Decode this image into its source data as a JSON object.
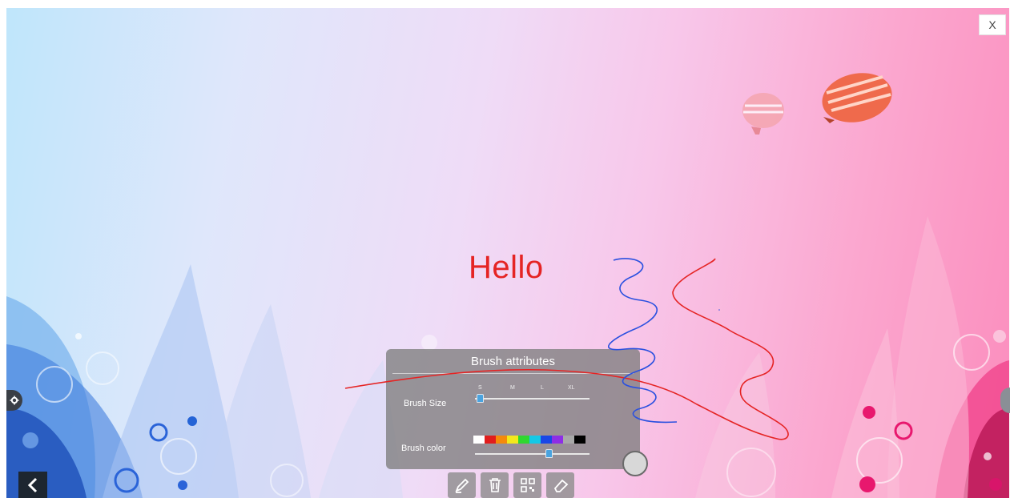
{
  "window": {
    "close_label": "X"
  },
  "canvas_text": {
    "greeting": "Hello"
  },
  "brush_panel": {
    "title": "Brush attributes",
    "size_label": "Brush Size",
    "size_ticks": [
      "S",
      "M",
      "L",
      "XL"
    ],
    "size_value": "S",
    "color_label": "Brush color",
    "colors": [
      "#ffffff",
      "#e11d1d",
      "#f58a0b",
      "#f3e81b",
      "#30d72f",
      "#14c8e6",
      "#1a47e6",
      "#8e2ee6",
      "#a8a8a8",
      "#000000"
    ],
    "color_slider_fraction": 0.64
  },
  "toolbar": {
    "icons": [
      "pen-icon",
      "trash-icon",
      "qr-code-icon",
      "eraser-icon"
    ]
  },
  "colors": {
    "ink_red": "#e52424",
    "ink_blue": "#2a50e0",
    "panel_bg": "#7d7d7d",
    "accent": "#4aa3df"
  }
}
